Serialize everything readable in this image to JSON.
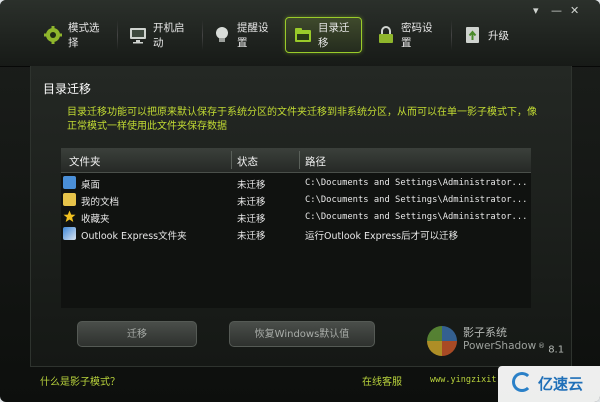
{
  "window": {
    "controls": [
      "▾",
      "—",
      "✕"
    ]
  },
  "tabs": [
    {
      "label": "模式选择",
      "icon": "gear-icon",
      "active": false
    },
    {
      "label": "开机启动",
      "icon": "monitor-icon",
      "active": false
    },
    {
      "label": "提醒设置",
      "icon": "bulb-icon",
      "active": false
    },
    {
      "label": "目录迁移",
      "icon": "folder-icon",
      "active": true
    },
    {
      "label": "密码设置",
      "icon": "lock-icon",
      "active": false
    },
    {
      "label": "升级",
      "icon": "upgrade-icon",
      "active": false
    }
  ],
  "panel": {
    "title": "目录迁移",
    "description": "目录迁移功能可以把原来默认保存于系统分区的文件夹迁移到非系统分区，从而可以在单一影子模式下，像正常模式一样使用此文件夹保存数据"
  },
  "table": {
    "headers": [
      "文件夹",
      "状态",
      "路径"
    ],
    "rows": [
      {
        "name": "桌面",
        "icon": "desktop-icon",
        "status": "未迁移",
        "path": "C:\\Documents and Settings\\Administrator..."
      },
      {
        "name": "我的文档",
        "icon": "documents-icon",
        "status": "未迁移",
        "path": "C:\\Documents and Settings\\Administrator..."
      },
      {
        "name": "收藏夹",
        "icon": "star-icon",
        "status": "未迁移",
        "path": "C:\\Documents and Settings\\Administrator..."
      },
      {
        "name": "Outlook Express文件夹",
        "icon": "outlook-icon",
        "status": "未迁移",
        "path": "运行Outlook Express后才可以迁移"
      }
    ]
  },
  "buttons": {
    "migrate": "迁移",
    "restore": "恢复Windows默认值"
  },
  "logo": {
    "name": "影子系统",
    "product": "PowerShadow",
    "version": "8.1",
    "registered": "®"
  },
  "footer": {
    "help": "什么是影子模式？",
    "support": "在线客服",
    "url": "www.yingzixit"
  },
  "watermark": {
    "text": "亿速云"
  },
  "colors": {
    "accent": "#9acb2a",
    "text_green": "#c2db33"
  }
}
